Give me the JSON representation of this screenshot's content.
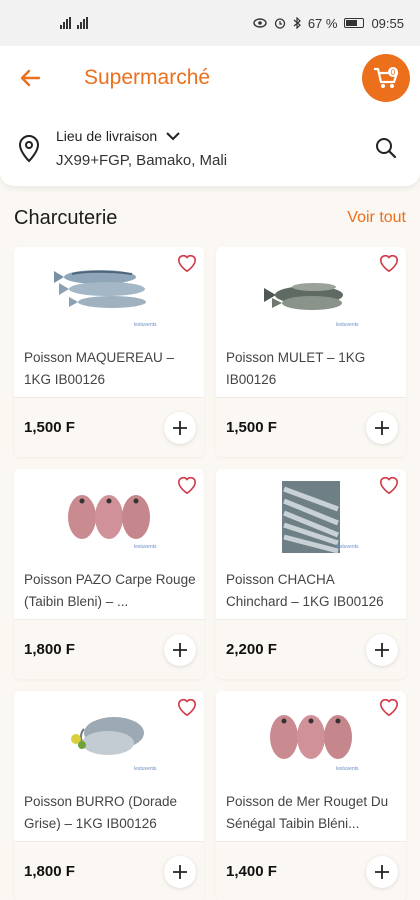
{
  "status_bar": {
    "network_left": "4G",
    "network_right": "4G",
    "battery_pct": "67 %",
    "time": "09:55"
  },
  "header": {
    "title": "Supermarché",
    "back_icon": "arrow-left-icon",
    "cart_icon": "cart-icon"
  },
  "address": {
    "label": "Lieu de livraison",
    "value": "JX99+FGP, Bamako, Mali"
  },
  "section": {
    "title": "Charcuterie",
    "see_all": "Voir tout"
  },
  "brand_text": "lestuvents",
  "products": [
    {
      "name": "Poisson MAQUEREAU – 1KG IB00126",
      "price": "1,500 F"
    },
    {
      "name": "Poisson MULET – 1KG IB00126",
      "price": "1,500 F"
    },
    {
      "name": "Poisson PAZO Carpe Rouge (Taibin Bleni) – ...",
      "price": "1,800 F"
    },
    {
      "name": "Poisson CHACHA Chinchard – 1KG IB00126",
      "price": "2,200 F"
    },
    {
      "name": "Poisson BURRO (Dorade Grise) – 1KG IB00126",
      "price": "1,800 F"
    },
    {
      "name": "Poisson de Mer Rouget Du Sénégal Taibin Bléni...",
      "price": "1,400 F"
    }
  ],
  "colors": {
    "accent": "#ec6f1c",
    "background": "#fbf7f2"
  }
}
